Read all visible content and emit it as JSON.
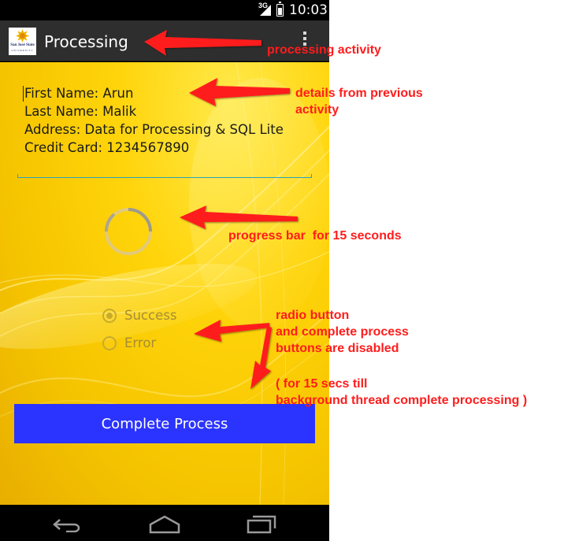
{
  "status_bar": {
    "network": "3G",
    "time": "10:03"
  },
  "action_bar": {
    "title": "Processing",
    "logo_text": "San José State",
    "logo_subtext": "UNIVERSITY",
    "overflow_icon": "overflow-menu-icon"
  },
  "details": {
    "first_name": "First Name: Arun",
    "last_name": "Last Name: Malik",
    "address": "Address: Data for Processing & SQL Lite",
    "credit_card": "Credit Card: 1234567890"
  },
  "progress": {
    "state": "indeterminate"
  },
  "radio_group": {
    "options": [
      {
        "label": "Success",
        "checked": true,
        "enabled": false
      },
      {
        "label": "Error",
        "checked": false,
        "enabled": false
      }
    ]
  },
  "complete_button": {
    "label": "Complete Process",
    "enabled": false
  },
  "nav_bar": {
    "icons": [
      "back-icon",
      "home-icon",
      "recents-icon"
    ]
  },
  "annotations": {
    "processing_activity": "processing activity",
    "details_note": "details from previous\nactivity",
    "progress_note": "progress bar  for 15 seconds",
    "disabled_note": "radio button\nand complete process\nbuttons are disabled",
    "timing_note": "( for 15 secs till\nbackground thread complete processing )"
  },
  "colors": {
    "content_background": "#ffd40a",
    "button_background": "#2b33ff",
    "annotation": "#ff1c1c",
    "action_bar": "#2e2e2e"
  }
}
